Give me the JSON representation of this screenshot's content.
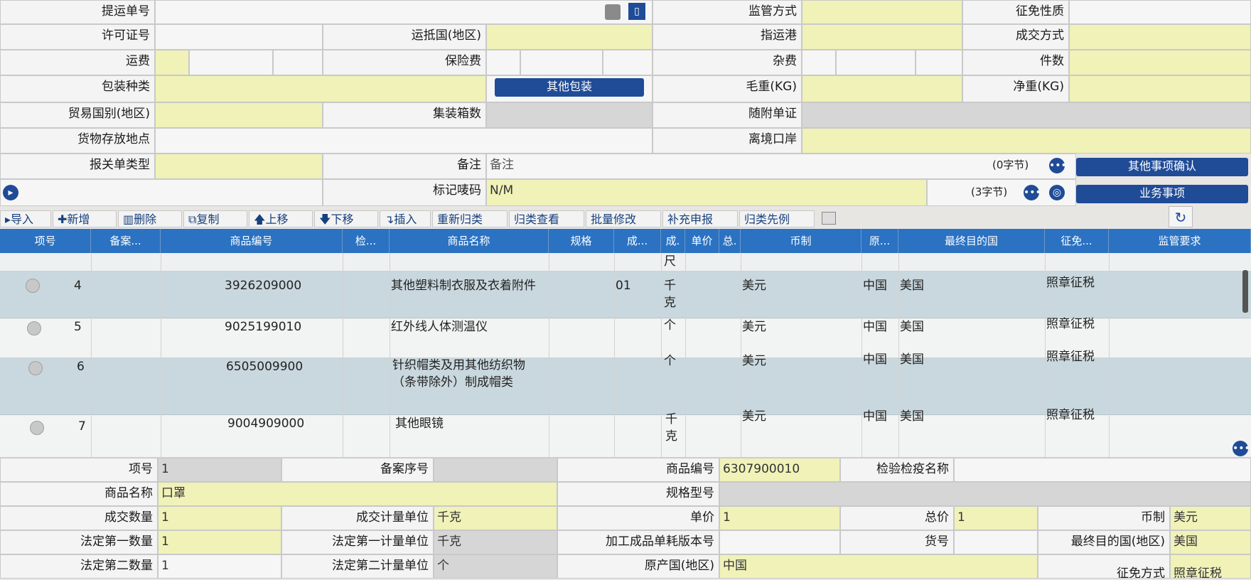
{
  "header_form": {
    "bill_no_label": "提运单号",
    "supervision_label": "监管方式",
    "tax_nature_label": "征免性质",
    "license_label": "许可证号",
    "dest_country_label": "运抵国(地区)",
    "port_label": "指运港",
    "trade_terms_label": "成交方式",
    "freight_label": "运费",
    "insurance_label": "保险费",
    "misc_fee_label": "杂费",
    "pieces_label": "件数",
    "package_label": "包装种类",
    "other_package_button": "其他包装",
    "gross_weight_label": "毛重(KG)",
    "net_weight_label": "净重(KG)",
    "trade_country_label": "贸易国别(地区)",
    "container_count_label": "集装箱数",
    "attached_docs_label": "随附单证",
    "storage_label": "货物存放地点",
    "exit_port_label": "离境口岸",
    "declaration_type_label": "报关单类型",
    "remark_label": "备注",
    "remark_value": "备注",
    "remark_bytes": "(0字节)",
    "other_confirm_button": "其他事项确认",
    "mark_label": "标记唛码",
    "mark_value": "N/M",
    "mark_bytes": "(3字节)",
    "business_button": "业务事项"
  },
  "toolbar": {
    "import": "导入",
    "add": "新增",
    "delete": "删除",
    "copy": "复制",
    "move_up": "上移",
    "move_down": "下移",
    "insert": "插入",
    "reclassify": "重新归类",
    "view_class": "归类查看",
    "batch_edit": "批量修改",
    "supplement": "补充申报",
    "precedent": "归类先例"
  },
  "table": {
    "headers": [
      "项号",
      "备案...",
      "商品编号",
      "检...",
      "商品名称",
      "规格",
      "成...",
      "成.",
      "单价",
      "总.",
      "币制",
      "原...",
      "最终目的国",
      "征免...",
      "监管要求"
    ],
    "partial_row_unit": "尺",
    "rows": [
      {
        "no": "4",
        "code": "3926209000",
        "name": "其他塑料制衣服及衣着附件",
        "spec": "01",
        "unit": "千克",
        "currency": "美元",
        "origin": "中国",
        "dest": "美国",
        "tax": "照章征税"
      },
      {
        "no": "5",
        "code": "9025199010",
        "name": "红外线人体测温仪",
        "spec": "",
        "unit": "个",
        "currency": "美元",
        "origin": "中国",
        "dest": "美国",
        "tax": "照章征税"
      },
      {
        "no": "6",
        "code": "6505009900",
        "name": "针织帽类及用其他纺织物（条带除外）制成帽类",
        "spec": "",
        "unit": "个",
        "currency": "美元",
        "origin": "中国",
        "dest": "美国",
        "tax": "照章征税"
      },
      {
        "no": "7",
        "code": "9004909000",
        "name": "其他眼镜",
        "spec": "",
        "unit": "千克",
        "currency": "美元",
        "origin": "中国",
        "dest": "美国",
        "tax": "照章征税"
      }
    ]
  },
  "detail_form": {
    "item_no_label": "项号",
    "item_no_value": "1",
    "record_no_label": "备案序号",
    "goods_code_label": "商品编号",
    "goods_code_value": "6307900010",
    "inspection_name_label": "检验检疫名称",
    "goods_name_label": "商品名称",
    "goods_name_value": "口罩",
    "spec_model_label": "规格型号",
    "deal_qty_label": "成交数量",
    "deal_qty_value": "1",
    "deal_unit_label": "成交计量单位",
    "deal_unit_value": "千克",
    "unit_price_label": "单价",
    "unit_price_value": "1",
    "total_price_label": "总价",
    "total_price_value": "1",
    "currency_label": "币制",
    "currency_value": "美元",
    "legal_qty1_label": "法定第一数量",
    "legal_qty1_value": "1",
    "legal_unit1_label": "法定第一计量单位",
    "legal_unit1_value": "千克",
    "version_label": "加工成品单耗版本号",
    "goods_no_label": "货号",
    "final_dest_label": "最终目的国(地区)",
    "final_dest_value": "美国",
    "legal_qty2_label": "法定第二数量",
    "legal_qty2_value": "1",
    "legal_unit2_label": "法定第二计量单位",
    "legal_unit2_value": "个",
    "origin_label": "原产国(地区)",
    "origin_value": "中国",
    "exemption_label": "征免方式",
    "exemption_value": "照章征税"
  }
}
